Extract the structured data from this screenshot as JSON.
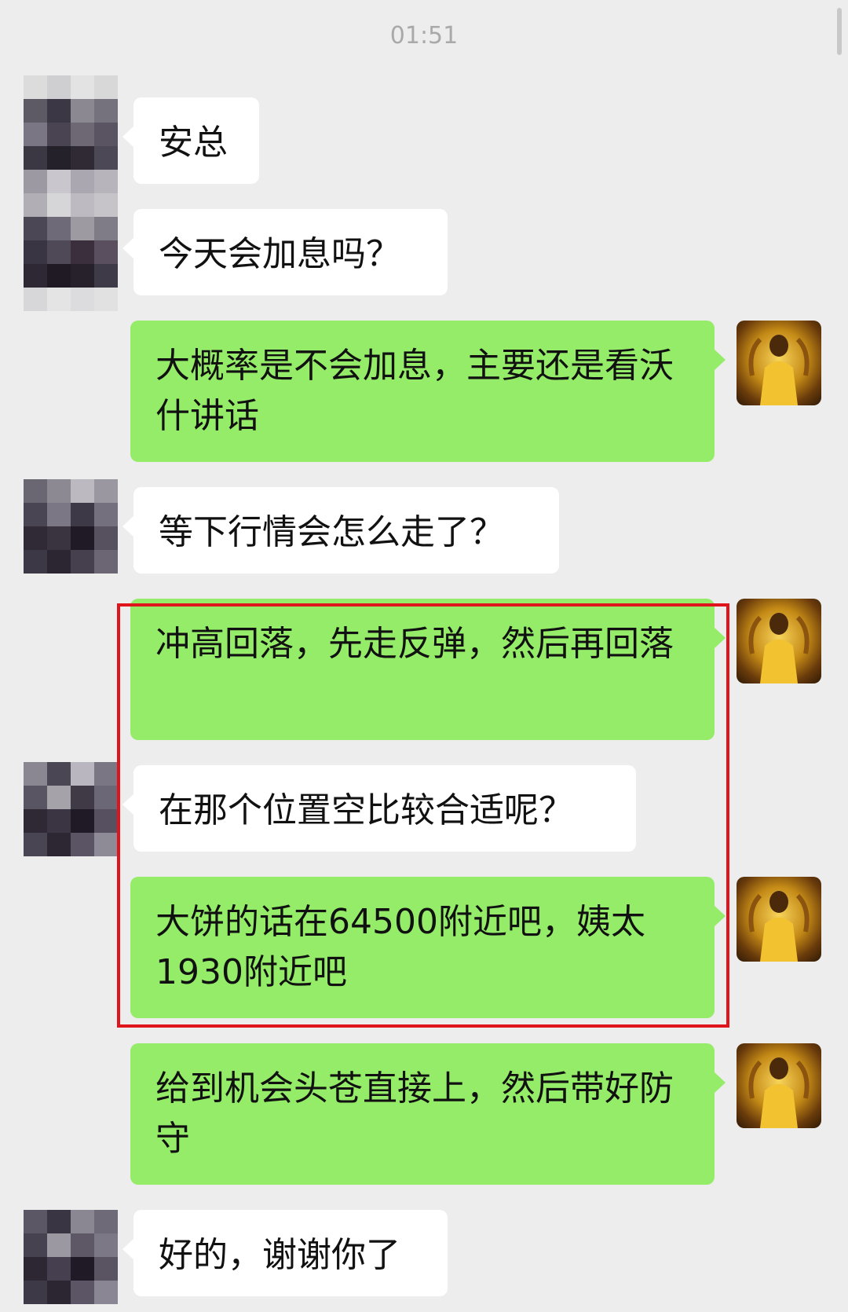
{
  "timestamp": "01:51",
  "colors": {
    "background": "#ededed",
    "incoming_bubble": "#ffffff",
    "outgoing_bubble": "#95ec69",
    "highlight_box": "#e0141c"
  },
  "contacts": {
    "other": {
      "avatar_icon": "pixelated-avatar-icon"
    },
    "self": {
      "avatar_icon": "gold-throne-avatar-icon"
    }
  },
  "messages": [
    {
      "from": "other",
      "text": "安总"
    },
    {
      "from": "other",
      "text": "今天会加息吗？"
    },
    {
      "from": "self",
      "text": "大概率是不会加息，主要还是看沃什讲话"
    },
    {
      "from": "other",
      "text": "等下行情会怎么走了？"
    },
    {
      "from": "self",
      "text": "冲高回落，先走反弹，然后再回落"
    },
    {
      "from": "other",
      "text": "在那个位置空比较合适呢？"
    },
    {
      "from": "self",
      "text": "大饼的话在64500附近吧，姨太1930附近吧"
    },
    {
      "from": "self",
      "text": "给到机会头苍直接上，然后带好防守"
    },
    {
      "from": "other",
      "text": "好的，谢谢你了"
    }
  ]
}
